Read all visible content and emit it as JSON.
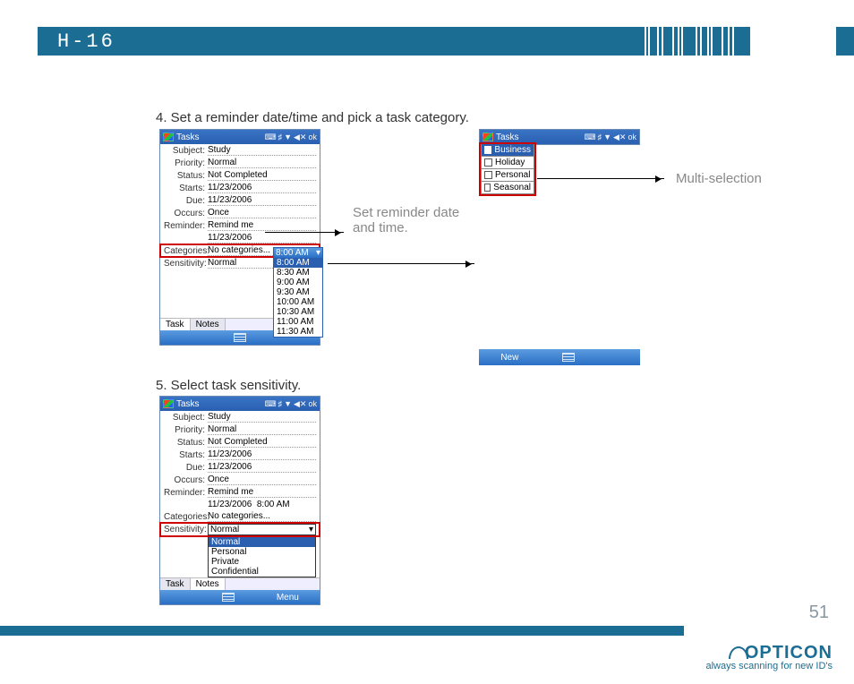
{
  "header": {
    "model": "H-16"
  },
  "steps": {
    "s4": "4. Set a reminder date/time and pick a task category.",
    "s5": "5. Select task sensitivity."
  },
  "annotations": {
    "reminder": "Set reminder date and time.",
    "multi": "Multi-selection"
  },
  "pda": {
    "title": "Tasks",
    "ok": "ok",
    "icons": [
      "⌨",
      "♯",
      "▼",
      "◀✕"
    ],
    "fields": {
      "subject_label": "Subject:",
      "subject": "Study",
      "priority_label": "Priority:",
      "priority": "Normal",
      "status_label": "Status:",
      "status": "Not Completed",
      "starts_label": "Starts:",
      "starts": "11/23/2006",
      "due_label": "Due:",
      "due": "11/23/2006",
      "occurs_label": "Occurs:",
      "occurs": "Once",
      "reminder_label": "Reminder:",
      "reminder": "Remind me",
      "reminder_date": "11/23/2006",
      "reminder_time": "8:00 AM",
      "categories_label": "Categories:",
      "categories": "No categories...",
      "sensitivity_label": "Sensitivity:",
      "sensitivity": "Normal"
    },
    "tabs": {
      "task": "Task",
      "notes": "Notes"
    },
    "bottom": {
      "new": "New",
      "menu": "Menu"
    }
  },
  "time_dropdown": {
    "header": "8:00 AM",
    "items": [
      "8:00 AM",
      "8:30 AM",
      "9:00 AM",
      "9:30 AM",
      "10:00 AM",
      "10:30 AM",
      "11:00 AM",
      "11:30 AM"
    ]
  },
  "categories_dropdown": {
    "items": [
      "Business",
      "Holiday",
      "Personal",
      "Seasonal"
    ]
  },
  "sensitivity_dropdown": {
    "items": [
      "Normal",
      "Personal",
      "Private",
      "Confidential"
    ]
  },
  "footer": {
    "page": "51",
    "brand": "OPTICON",
    "tagline": "always scanning for new ID's"
  }
}
